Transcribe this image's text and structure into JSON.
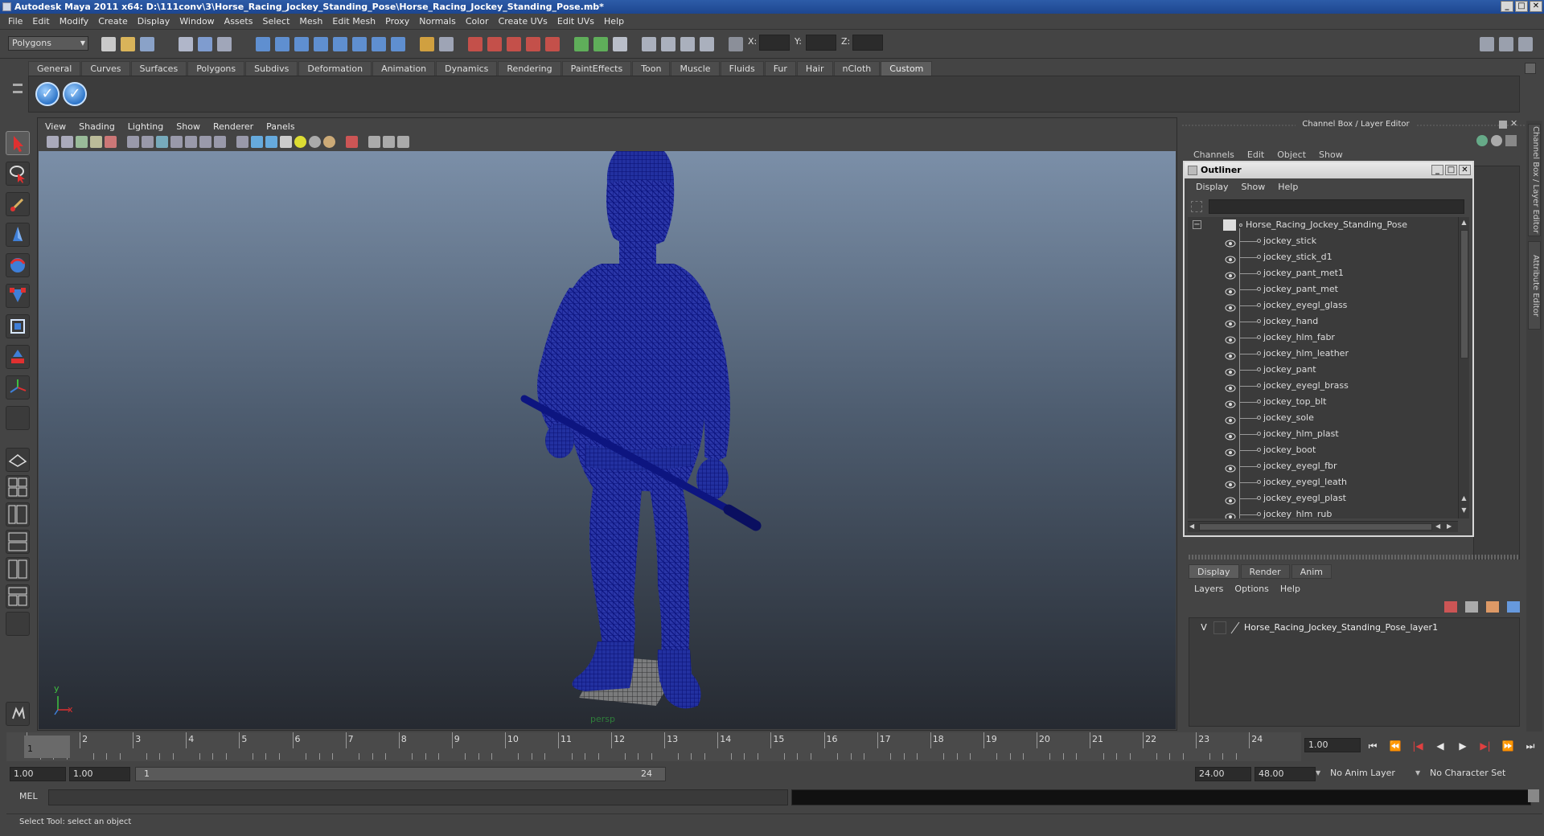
{
  "window": {
    "title": "Autodesk Maya 2011 x64: D:\\111conv\\3\\Horse_Racing_Jockey_Standing_Pose\\Horse_Racing_Jockey_Standing_Pose.mb*",
    "minimize": "_",
    "maximize": "□",
    "close": "✕"
  },
  "menubar": [
    "File",
    "Edit",
    "Modify",
    "Create",
    "Display",
    "Window",
    "Assets",
    "Select",
    "Mesh",
    "Edit Mesh",
    "Proxy",
    "Normals",
    "Color",
    "Create UVs",
    "Edit UVs",
    "Help"
  ],
  "statusline": {
    "mode": "Polygons",
    "x_label": "X:",
    "y_label": "Y:",
    "z_label": "Z:"
  },
  "shelf": {
    "tabs": [
      "General",
      "Curves",
      "Surfaces",
      "Polygons",
      "Subdivs",
      "Deformation",
      "Animation",
      "Dynamics",
      "Rendering",
      "PaintEffects",
      "Toon",
      "Muscle",
      "Fluids",
      "Fur",
      "Hair",
      "nCloth",
      "Custom"
    ],
    "active_tab": "Custom",
    "buttons": [
      "check-icon",
      "check-icon"
    ]
  },
  "viewport": {
    "menu": [
      "View",
      "Shading",
      "Lighting",
      "Show",
      "Renderer",
      "Panels"
    ],
    "camera": "persp",
    "axis_y": "y",
    "axis_x": "x"
  },
  "channel_box": {
    "title": "Channel Box / Layer Editor",
    "menu": [
      "Channels",
      "Edit",
      "Object",
      "Show"
    ]
  },
  "outliner": {
    "title": "Outliner",
    "menu": [
      "Display",
      "Show",
      "Help"
    ],
    "root": "Horse_Racing_Jockey_Standing_Pose",
    "items": [
      "jockey_stick",
      "jockey_stick_d1",
      "jockey_pant_met1",
      "jockey_pant_met",
      "jockey_eyegl_glass",
      "jockey_hand",
      "jockey_hlm_fabr",
      "jockey_hlm_leather",
      "jockey_pant",
      "jockey_eyegl_brass",
      "jockey_top_blt",
      "jockey_sole",
      "jockey_hlm_plast",
      "jockey_boot",
      "jockey_eyegl_fbr",
      "jockey_eyegl_leath",
      "jockey_eyegl_plast",
      "jockey_hlm_rub"
    ],
    "collapse": "−"
  },
  "layers": {
    "tabs": [
      "Display",
      "Render",
      "Anim"
    ],
    "active_tab": "Display",
    "menu": [
      "Layers",
      "Options",
      "Help"
    ],
    "rows": [
      {
        "visible": "V",
        "name": "Horse_Racing_Jockey_Standing_Pose_layer1"
      }
    ]
  },
  "side_tabs": [
    "Channel Box / Layer Editor",
    "Attribute Editor"
  ],
  "timeline": {
    "ticks": [
      "1",
      "2",
      "3",
      "4",
      "5",
      "6",
      "7",
      "8",
      "9",
      "10",
      "11",
      "12",
      "13",
      "14",
      "15",
      "16",
      "17",
      "18",
      "19",
      "20",
      "21",
      "22",
      "23",
      "24"
    ],
    "current_frame_marker": "1",
    "current_frame": "1.00"
  },
  "playback": [
    "⏮",
    "⏪",
    "|◀",
    "◀",
    "▶",
    "▶|",
    "⏩",
    "⏭"
  ],
  "range": {
    "start_time": "1.00",
    "playback_start": "1.00",
    "range_start_label": "1",
    "range_end_label": "24",
    "playback_end": "24.00",
    "end_time": "48.00",
    "anim_layer": "No Anim Layer",
    "character_set": "No Character Set"
  },
  "command_line": {
    "label": "MEL"
  },
  "help_line": {
    "text": "Select Tool: select an object"
  },
  "colors": {
    "wireframe": "#0e1590",
    "titlebar": "#2d5ca8",
    "viewport_top": "#7b8fa8",
    "viewport_bottom": "#262a31"
  }
}
